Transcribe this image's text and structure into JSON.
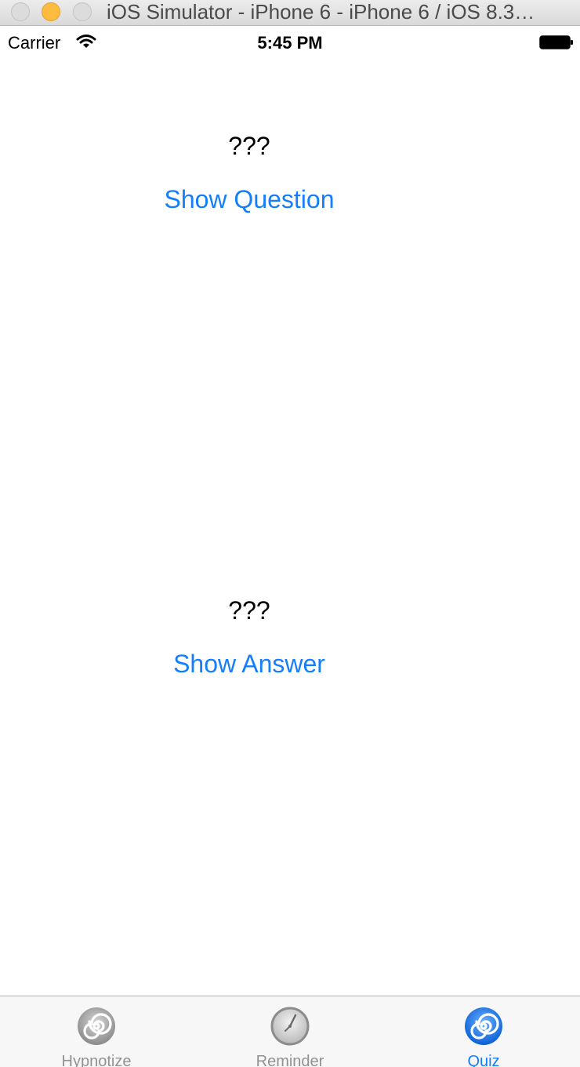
{
  "window": {
    "title": "iOS Simulator - iPhone 6 - iPhone 6 / iOS 8.3…"
  },
  "status_bar": {
    "carrier": "Carrier",
    "time": "5:45 PM"
  },
  "quiz": {
    "question_text": "???",
    "show_question_label": "Show Question",
    "answer_text": "???",
    "show_answer_label": "Show Answer"
  },
  "tab_bar": {
    "tabs": [
      {
        "label": "Hypnotize",
        "icon": "spiral-icon",
        "selected": false
      },
      {
        "label": "Reminder",
        "icon": "clock-icon",
        "selected": false
      },
      {
        "label": "Quiz",
        "icon": "spiral-icon",
        "selected": true
      }
    ],
    "active_color": "#157efb",
    "inactive_color": "#929292"
  }
}
